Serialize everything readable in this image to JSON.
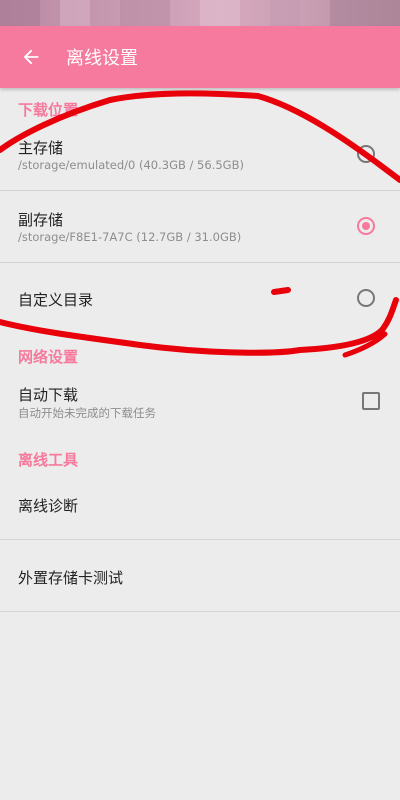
{
  "app_bar": {
    "title": "离线设置",
    "back_icon": "arrow-left-icon"
  },
  "sections": {
    "download_location": {
      "header": "下载位置",
      "items": [
        {
          "title": "主存储",
          "subtitle": "/storage/emulated/0 (40.3GB / 56.5GB)",
          "selected": false
        },
        {
          "title": "副存储",
          "subtitle": "/storage/F8E1-7A7C (12.7GB / 31.0GB)",
          "selected": true
        },
        {
          "title": "自定义目录",
          "selected": false
        }
      ]
    },
    "network": {
      "header": "网络设置",
      "auto_download": {
        "title": "自动下载",
        "subtitle": "自动开始未完成的下载任务",
        "checked": false
      }
    },
    "offline_tools": {
      "header": "离线工具",
      "items": [
        {
          "title": "离线诊断"
        },
        {
          "title": "外置存储卡测试"
        }
      ]
    }
  },
  "colors": {
    "accent": "#f57a9d",
    "annotation": "#e8000a",
    "background": "#ececec"
  }
}
